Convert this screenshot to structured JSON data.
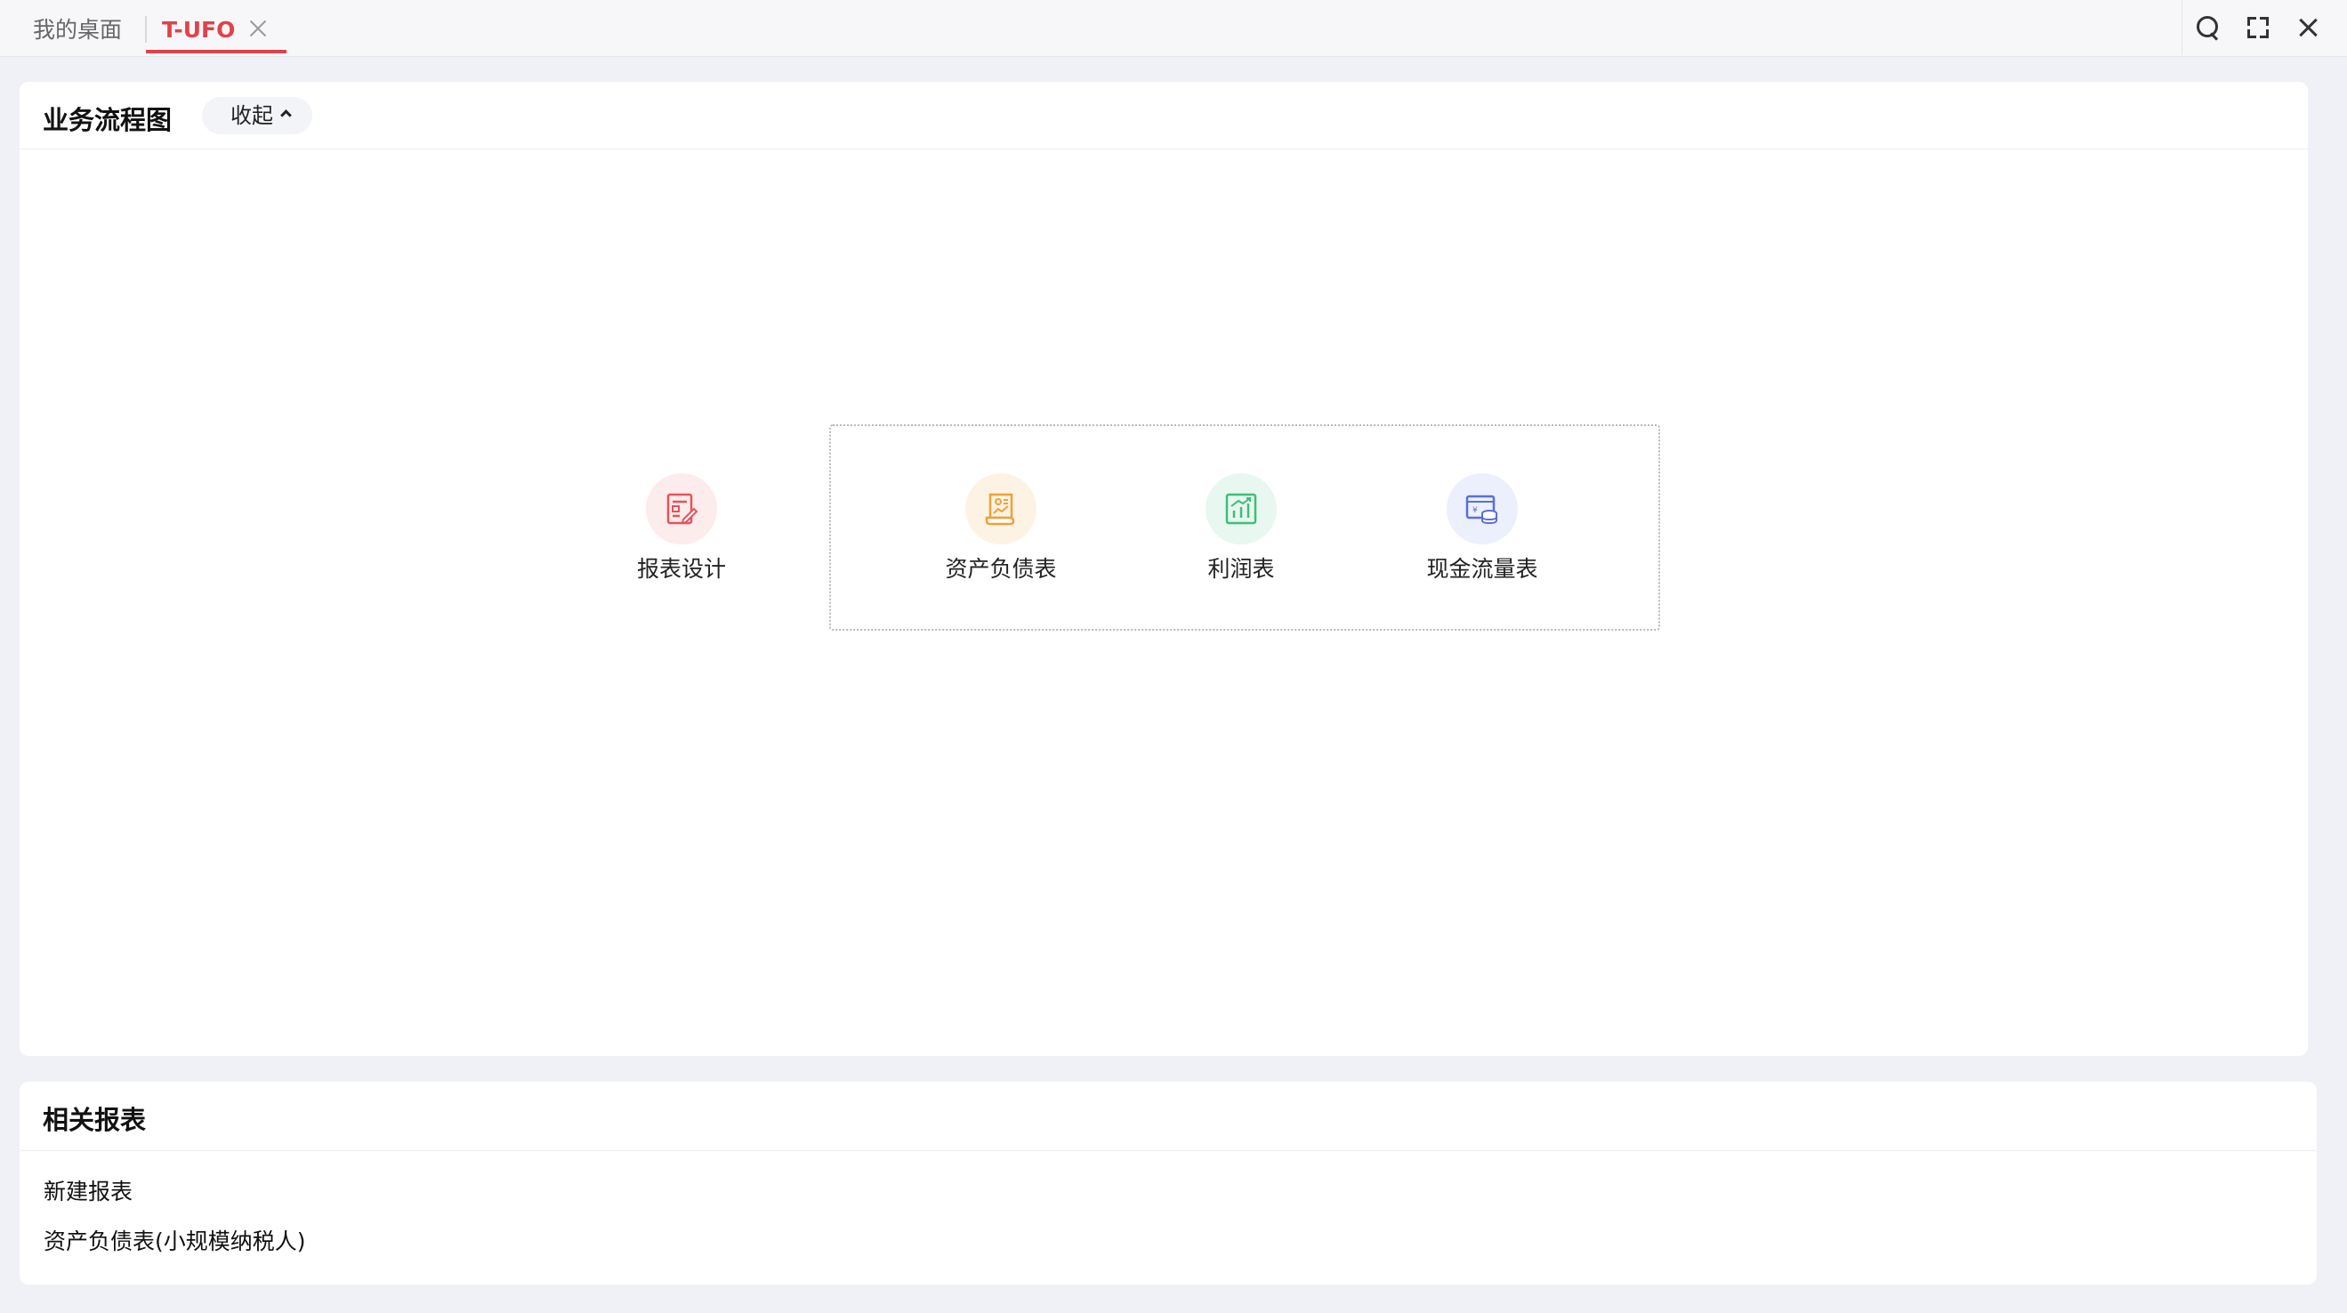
{
  "tabs": {
    "home_label": "我的桌面",
    "active_label": "T-UFO"
  },
  "toolbar": {
    "search_icon": "search-icon",
    "expand_icon": "fullscreen-icon",
    "close_icon": "close-icon"
  },
  "flow": {
    "title": "业务流程图",
    "collapse_label": "收起",
    "nodes": [
      {
        "label": "报表设计",
        "icon": "report-design-icon",
        "color": "#e8525a",
        "bg": "#fdecec"
      },
      {
        "label": "资产负债表",
        "icon": "balance-sheet-icon",
        "color": "#f0a03a",
        "bg": "#fdf3e4"
      },
      {
        "label": "利润表",
        "icon": "profit-chart-icon",
        "color": "#3cbf7a",
        "bg": "#e8f7ef"
      },
      {
        "label": "现金流量表",
        "icon": "cash-flow-icon",
        "color": "#5a6fd8",
        "bg": "#eceffc"
      }
    ]
  },
  "related": {
    "title": "相关报表",
    "items": [
      "新建报表",
      "资产负债表(小规模纳税人)"
    ]
  },
  "colors": {
    "accent": "#e1424a",
    "background": "#f0f1f6"
  }
}
